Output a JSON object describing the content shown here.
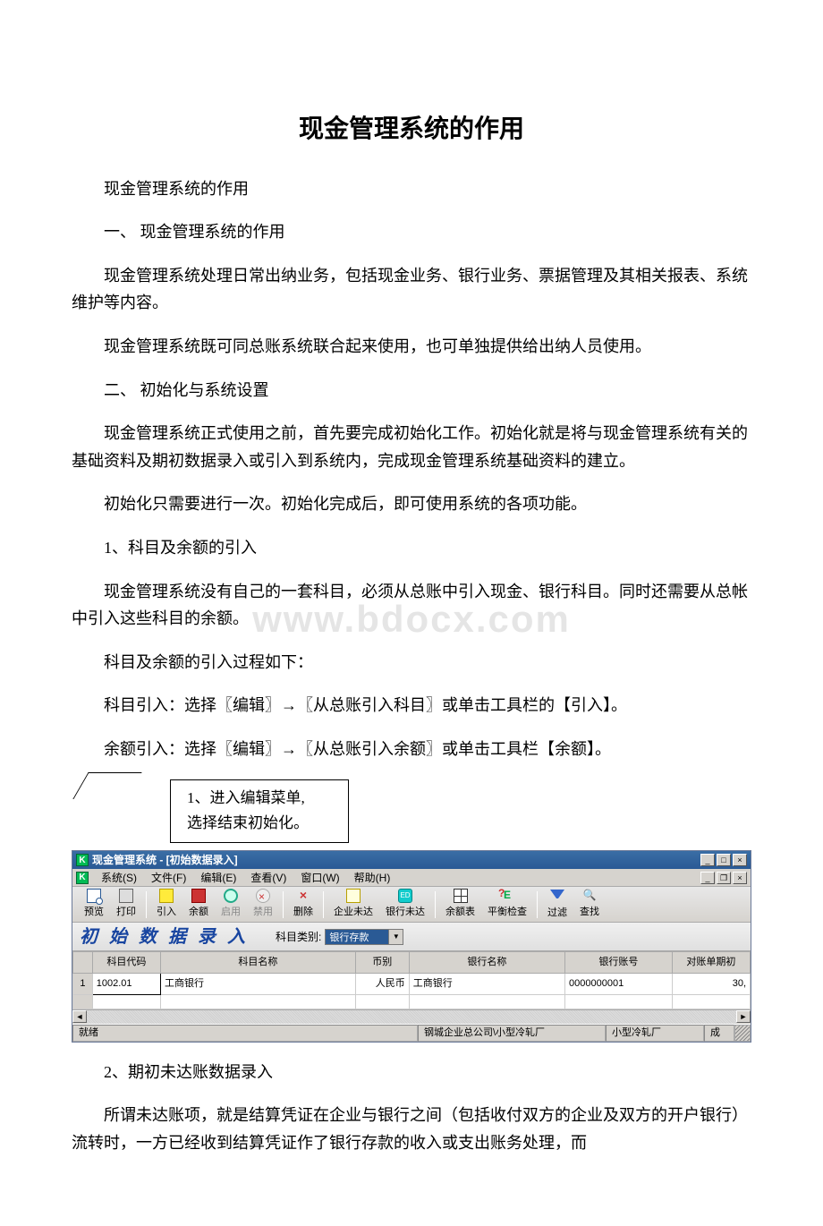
{
  "doc": {
    "title": "现金管理系统的作用",
    "p1": "现金管理系统的作用",
    "p2": "一、 现金管理系统的作用",
    "p3": "现金管理系统处理日常出纳业务，包括现金业务、银行业务、票据管理及其相关报表、系统维护等内容。",
    "p4": "现金管理系统既可同总账系统联合起来使用，也可单独提供给出纳人员使用。",
    "p5": "二、 初始化与系统设置",
    "p6": "现金管理系统正式使用之前，首先要完成初始化工作。初始化就是将与现金管理系统有关的基础资料及期初数据录入或引入到系统内，完成现金管理系统基础资料的建立。",
    "p7": "初始化只需要进行一次。初始化完成后，即可使用系统的各项功能。",
    "p8": "1、科目及余额的引入",
    "p9": "现金管理系统没有自己的一套科目，必须从总账中引入现金、银行科目。同时还需要从总帐中引入这些科目的余额。",
    "p10": "科目及余额的引入过程如下：",
    "p11": "科目引入：选择〖编辑〗→〖从总账引入科目〗或单击工具栏的【引入】。",
    "p12": "余额引入：选择〖编辑〗→〖从总账引入余额〗或单击工具栏【余额】。",
    "callout1": "1、进入编辑菜单,",
    "callout2": "选择结束初始化。",
    "p13": "2、期初未达账数据录入",
    "p14": "所谓未达账项，就是结算凭证在企业与银行之间（包括收付双方的企业及双方的开户银行）流转时，一方已经收到结算凭证作了银行存款的收入或支出账务处理，而"
  },
  "watermark": "www.bdocx.com",
  "app": {
    "title": "现金管理系统 - [初始数据录入]",
    "menus": {
      "system": "系统(S)",
      "file": "文件(F)",
      "edit": "编辑(E)",
      "view": "查看(V)",
      "window": "窗口(W)",
      "help": "帮助(H)"
    },
    "tools": {
      "preview": "预览",
      "print": "打印",
      "import": "引入",
      "balance": "余额",
      "enable": "启用",
      "disable": "禁用",
      "delete": "删除",
      "corp_pending": "企业未达",
      "bank_pending": "银行未达",
      "balance_sheet": "余额表",
      "balance_check": "平衡检查",
      "filter": "过滤",
      "find": "查找"
    },
    "header": {
      "title": "初 始 数 据 录 入",
      "label": "科目类别:",
      "combo_value": "银行存款"
    },
    "grid": {
      "cols": {
        "rownum": "",
        "code": "科目代码",
        "name": "科目名称",
        "currency": "币别",
        "bank_name": "银行名称",
        "bank_acct": "银行账号",
        "period_init": "对账单期初"
      },
      "row": {
        "n": "1",
        "code": "1002.01",
        "name": "工商银行",
        "currency": "人民币",
        "bank_name": "工商银行",
        "bank_acct": "0000000001",
        "period_init": "30,"
      }
    },
    "status": {
      "ready": "就绪",
      "org": "钢城企业总公司\\小型冷轧厂",
      "unit": "小型冷轧厂",
      "flag": "成"
    }
  }
}
